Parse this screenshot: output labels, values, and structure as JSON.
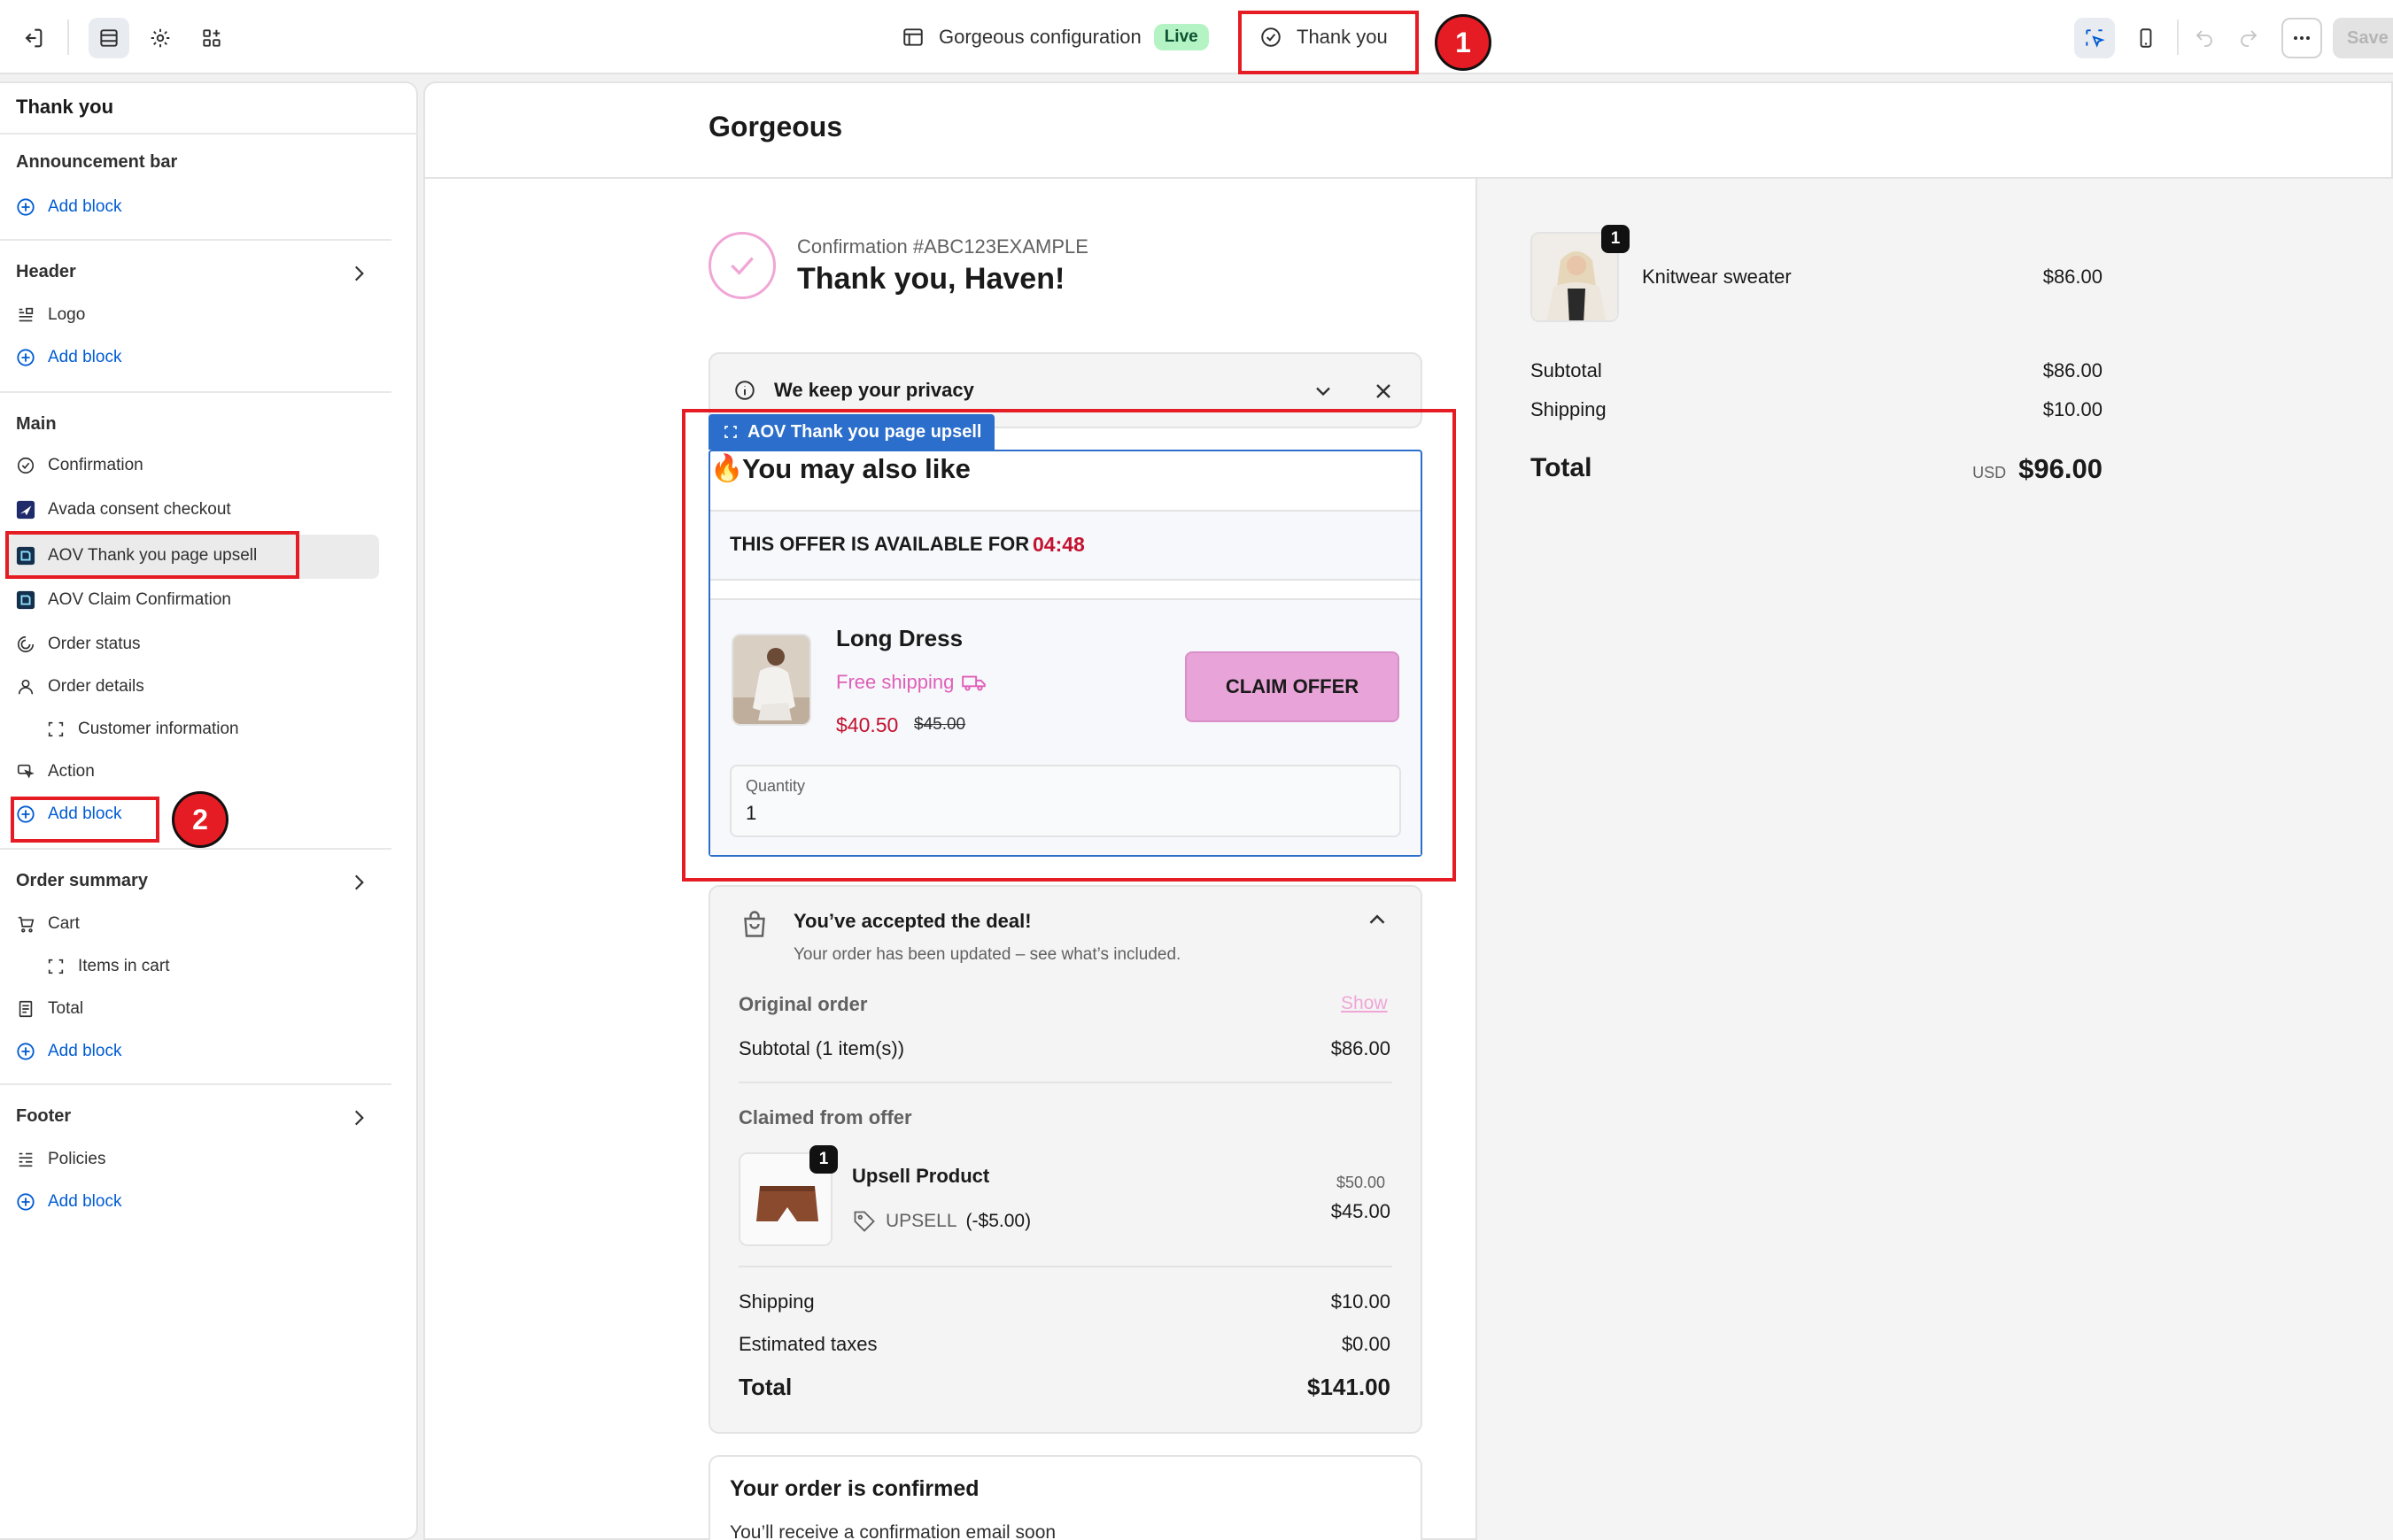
{
  "topbar": {
    "config_name": "Gorgeous configuration",
    "live_label": "Live",
    "page_name": "Thank you",
    "save_label": "Save",
    "annotation_1": "1"
  },
  "sidebar": {
    "title": "Thank you",
    "add_block": "Add block",
    "sections": {
      "announcement": "Announcement bar",
      "header": "Header",
      "main": "Main",
      "order_summary": "Order summary",
      "footer": "Footer"
    },
    "header_items": [
      "Logo"
    ],
    "main_items": [
      "Confirmation",
      "Avada consent checkout",
      "AOV Thank you page upsell",
      "AOV Claim Confirmation",
      "Order status",
      "Order details",
      "Customer information",
      "Action"
    ],
    "summary_items": [
      "Cart",
      "Items in cart",
      "Total"
    ],
    "footer_items": [
      "Policies"
    ],
    "annotation_2": "2"
  },
  "preview": {
    "store_name": "Gorgeous",
    "confirmation_number": "Confirmation #ABC123EXAMPLE",
    "thank_you": "Thank you, Haven!",
    "privacy": "We keep your privacy",
    "upsell_tag": "AOV Thank you page upsell",
    "upsell_title": "You may also like",
    "offer_text": "THIS OFFER IS AVAILABLE FOR",
    "offer_timer": "04:48",
    "product_name": "Long Dress",
    "free_shipping": "Free shipping",
    "price": "$40.50",
    "compare_price": "$45.00",
    "claim_button": "CLAIM OFFER",
    "quantity_label": "Quantity",
    "quantity_value": "1",
    "accepted_title": "You’ve accepted the deal!",
    "accepted_sub": "Your order has been updated – see what’s included.",
    "original_order": "Original order",
    "show_link": "Show",
    "subtotal_label": "Subtotal (1 item(s))",
    "subtotal_value": "$86.00",
    "claimed_from": "Claimed from offer",
    "upsell_product": "Upsell Product",
    "upsell_qty": "1",
    "upsell_code": "UPSELL",
    "upsell_discount": "(-$5.00)",
    "upsell_original": "$50.00",
    "upsell_price": "$45.00",
    "shipping_label": "Shipping",
    "shipping_value": "$10.00",
    "taxes_label": "Estimated taxes",
    "taxes_value": "$0.00",
    "total_label": "Total",
    "total_value": "$141.00",
    "confirmed_title": "Your order is confirmed",
    "confirmed_sub": "You’ll receive a confirmation email soon"
  },
  "summary": {
    "item_name": "Knitwear sweater",
    "item_qty": "1",
    "item_price": "$86.00",
    "subtotal_label": "Subtotal",
    "subtotal_value": "$86.00",
    "shipping_label": "Shipping",
    "shipping_value": "$10.00",
    "total_label": "Total",
    "currency": "USD",
    "total_value": "$96.00"
  },
  "colors": {
    "accent_blue": "#005bd3",
    "annotation_red": "#e51c23",
    "claim_pink": "#e8a4d8",
    "price_red": "#c4122f",
    "shipping_pink": "#e05fb7"
  }
}
